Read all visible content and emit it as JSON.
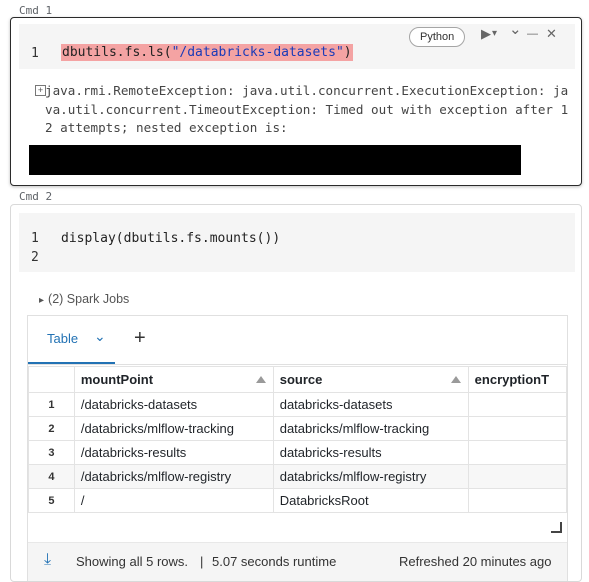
{
  "cmd1": {
    "label": "Cmd 1",
    "line_numbers": [
      "1"
    ],
    "code_fn": "dbutils.fs.ls(",
    "code_str": "\"/databricks-datasets\"",
    "code_end": ")",
    "language": "Python",
    "run_icon": "▶",
    "run_menu_icon": "▾",
    "collapse_icon": "⌄",
    "minimize_icon": "—",
    "close_icon": "✕",
    "expand_icon": "+",
    "error_text": "java.rmi.RemoteException: java.util.concurrent.ExecutionException: java.util.concurrent.TimeoutException: Timed out with exception after 12 attempts; nested exception is:"
  },
  "cmd2": {
    "label": "Cmd 2",
    "line_numbers": [
      "1",
      "2"
    ],
    "code": "display(dbutils.fs.mounts())",
    "spark_jobs": "(2) Spark Jobs",
    "spark_caret": "▸"
  },
  "result": {
    "tab_label": "Table",
    "tab_chevron": "⌄",
    "add_tab": "+",
    "columns": [
      "mountPoint",
      "source",
      "encryptionT"
    ],
    "rows": [
      {
        "idx": "1",
        "mountPoint": "/databricks-datasets",
        "source": "databricks-datasets",
        "encryption": ""
      },
      {
        "idx": "2",
        "mountPoint": "/databricks/mlflow-tracking",
        "source": "databricks/mlflow-tracking",
        "encryption": ""
      },
      {
        "idx": "3",
        "mountPoint": "/databricks-results",
        "source": "databricks-results",
        "encryption": ""
      },
      {
        "idx": "4",
        "mountPoint": "/databricks/mlflow-registry",
        "source": "databricks/mlflow-registry",
        "encryption": ""
      },
      {
        "idx": "5",
        "mountPoint": "/",
        "source": "DatabricksRoot",
        "encryption": ""
      }
    ],
    "download_icon": "⤓",
    "footer_summary": "Showing all 5 rows.",
    "footer_sep": "|",
    "footer_runtime": "5.07 seconds runtime",
    "footer_refreshed": "Refreshed 20 minutes ago"
  }
}
